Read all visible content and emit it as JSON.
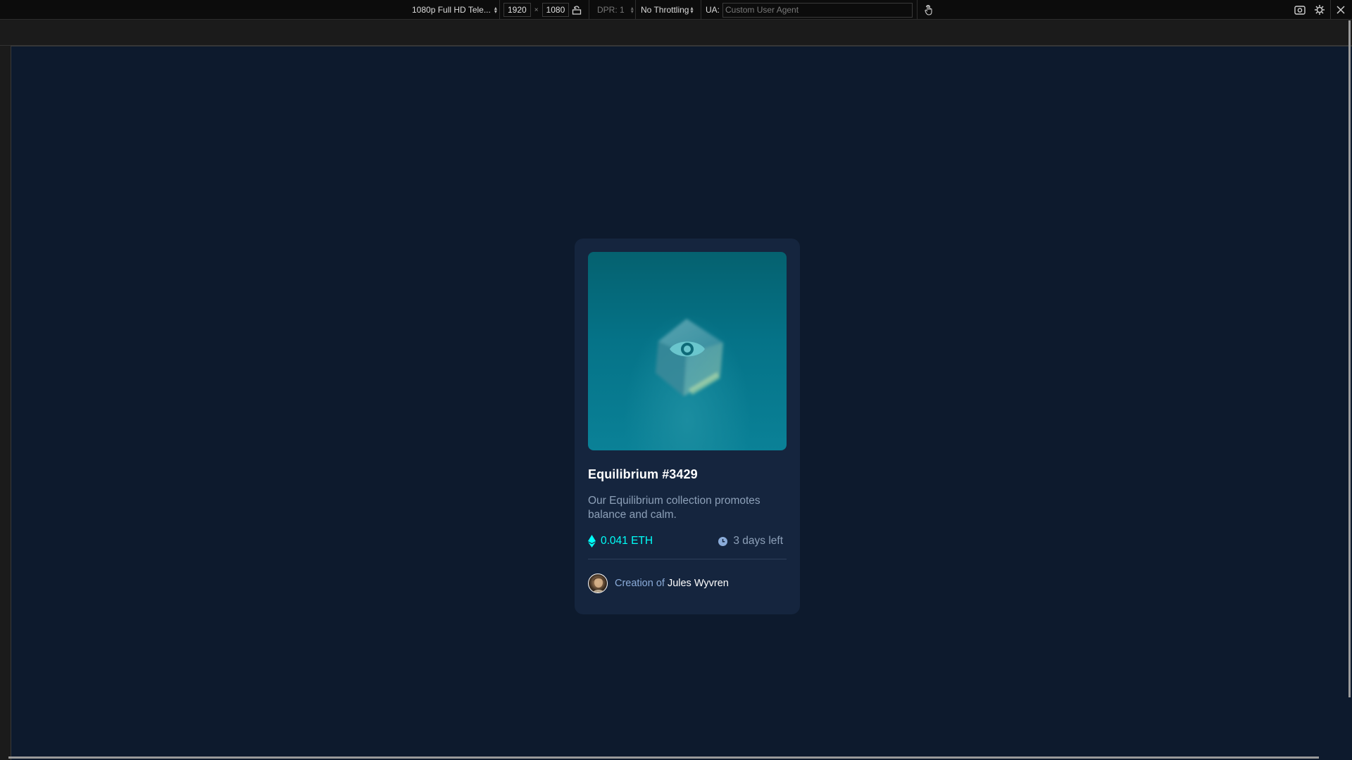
{
  "toolbar": {
    "device_preset": "1080p Full HD Tele...",
    "width": "1920",
    "height": "1080",
    "times_symbol": "×",
    "dpr_label": "DPR: 1",
    "throttling": "No Throttling",
    "ua_label": "UA:",
    "ua_placeholder": "Custom User Agent",
    "icons": {
      "rotate": "rotate-icon",
      "touch": "touch-hand-icon",
      "screenshot": "camera-icon",
      "settings": "gear-icon",
      "close": "close-icon"
    }
  },
  "card": {
    "image_alt": "Equilibrium crystal cube",
    "overlay_icon": "eye-icon",
    "title": "Equilibrium #3429",
    "description": "Our Equilibrium collection promotes balance and calm.",
    "price": "0.041 ETH",
    "price_icon": "ethereum-icon",
    "time_left": "3 days left",
    "time_icon": "clock-icon",
    "creator_prefix": "Creation of",
    "creator_name": "Jules Wyvren"
  },
  "colors": {
    "page_bg": "#0d1a2d",
    "card_bg": "#15253e",
    "accent_cyan": "#00fff8",
    "soft_blue": "#8bacd9",
    "muted_text": "#8da0b8",
    "white": "#ffffff"
  }
}
